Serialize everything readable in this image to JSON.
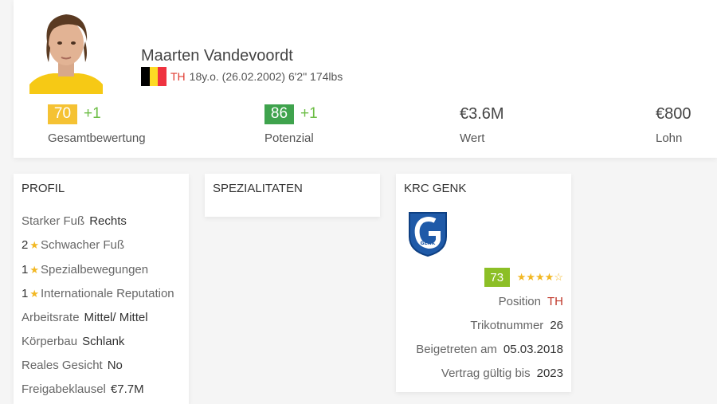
{
  "player": {
    "name": "Maarten Vandevoordt",
    "position": "TH",
    "details": "18y.o. (26.02.2002) 6'2\" 174lbs"
  },
  "colors": {
    "yellow_badge": "#f5c233",
    "green_badge": "#3fa34d",
    "club_green_badge": "#8cbf26",
    "plus": "#6cbd45",
    "star": "#f2b824",
    "position_red": "#e03c31",
    "flag": [
      "#000000",
      "#fdda24",
      "#ef3340"
    ]
  },
  "stats": [
    {
      "badge": "70",
      "plus": "+1",
      "label": "Gesamtbewertung"
    },
    {
      "badge": "86",
      "plus": "+1",
      "label": "Potenzial"
    },
    {
      "value": "€3.6M",
      "label": "Wert"
    },
    {
      "value": "€800",
      "label": "Lohn"
    }
  ],
  "profile": {
    "title": "PROFIL",
    "rows": [
      {
        "label": "Starker Fuß",
        "value": "Rechts"
      },
      {
        "count": "2",
        "label": "Schwacher Fuß"
      },
      {
        "count": "1",
        "label": "Spezialbewegungen"
      },
      {
        "count": "1",
        "label": "Internationale Reputation"
      },
      {
        "label": "Arbeitsrate",
        "value": "Mittel/ Mittel"
      },
      {
        "label": "Körperbau",
        "value": "Schlank"
      },
      {
        "label": "Reales Gesicht",
        "value": "No"
      },
      {
        "label": "Freigabeklausel",
        "value": "€7.7M"
      }
    ]
  },
  "specialities": {
    "title": "SPEZIALITATEN"
  },
  "club": {
    "title": "KRC GENK",
    "logo_text": "GENK",
    "rating": "73",
    "stars_filled": "★★★★",
    "stars_empty": "☆",
    "rows": [
      {
        "label": "Position",
        "value": "TH"
      },
      {
        "label": "Trikotnummer",
        "value": "26"
      },
      {
        "label": "Beigetreten am",
        "value": "05.03.2018"
      },
      {
        "label": "Vertrag gültig bis",
        "value": "2023"
      }
    ]
  }
}
